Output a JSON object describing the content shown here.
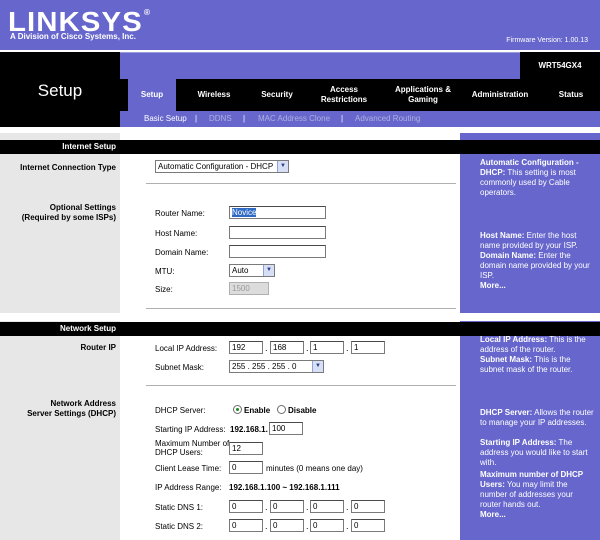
{
  "header": {
    "brand": "LINKSYS",
    "brand_mark": "®",
    "tagline": "A Division of Cisco Systems, Inc.",
    "firmware": "Firmware Version: 1.00.13"
  },
  "page_title": "Setup",
  "model": "WRT54GX4",
  "tabs": [
    {
      "label": "Setup"
    },
    {
      "label": "Wireless"
    },
    {
      "label": "Security"
    },
    {
      "label": "Access Restrictions"
    },
    {
      "label": "Applications & Gaming"
    },
    {
      "label": "Administration"
    },
    {
      "label": "Status"
    }
  ],
  "subnav": {
    "items": [
      "Basic Setup",
      "DDNS",
      "MAC Address Clone",
      "Advanced Routing"
    ],
    "separator": "|"
  },
  "left": {
    "internet_setup": "Internet Setup",
    "connection_type": "Internet Connection Type",
    "optional_settings_1": "Optional Settings",
    "optional_settings_2": "(Required by some ISPs)",
    "network_setup": "Network Setup",
    "router_ip": "Router IP",
    "dhcp_1": "Network Address",
    "dhcp_2": "Server Settings (DHCP)"
  },
  "form": {
    "connection_type_value": "Automatic Configuration - DHCP",
    "router_name_label": "Router Name:",
    "router_name_value": "Novice",
    "host_name_label": "Host Name:",
    "host_name_value": "",
    "domain_name_label": "Domain Name:",
    "domain_name_value": "",
    "mtu_label": "MTU:",
    "mtu_value": "Auto",
    "size_label": "Size:",
    "size_value": "1500",
    "local_ip_label": "Local IP Address:",
    "local_ip": [
      "192",
      "168",
      "1",
      "1"
    ],
    "subnet_label": "Subnet Mask:",
    "subnet_value": "255 . 255 . 255 . 0",
    "dhcp_server_label": "DHCP Server:",
    "enable_label": "Enable",
    "disable_label": "Disable",
    "start_ip_label": "Starting IP Address:",
    "start_ip_prefix": "192.168.1.",
    "start_ip_value": "100",
    "max_users_label": "Maximum Number of DHCP Users:",
    "max_users_value": "12",
    "lease_label": "Client Lease Time:",
    "lease_value": "0",
    "lease_suffix": "minutes (0 means one day)",
    "range_label": "IP Address Range:",
    "range_value": "192.168.1.100 ~ 192.168.1.111",
    "dns1_label": "Static DNS 1:",
    "dns1": [
      "0",
      "0",
      "0",
      "0"
    ],
    "dns2_label": "Static DNS 2:",
    "dns2": [
      "0",
      "0",
      "0",
      "0"
    ],
    "dot": "."
  },
  "help": {
    "auto_title": "Automatic Configuration - DHCP:",
    "auto_text": " This setting is most commonly used by Cable operators.",
    "host_title": "Host Name:",
    "host_text": " Enter the host name provided by your ISP.",
    "domain_title": "Domain Name:",
    "domain_text": " Enter the domain name provided by your ISP.",
    "more1": "More...",
    "localip_title": "Local IP Address:",
    "localip_text": " This is the address of the router.",
    "subnet_title": "Subnet Mask:",
    "subnet_text": " This is the subnet mask of the router.",
    "dhcp_title": "DHCP Server:",
    "dhcp_text": " Allows the router to manage your IP addresses.",
    "startip_title": "Starting IP Address:",
    "startip_text": " The address you would like to start with.",
    "max_title": "Maximum number of DHCP Users:",
    "max_text": " You may limit the number of addresses your router hands out.",
    "more2": "More..."
  }
}
